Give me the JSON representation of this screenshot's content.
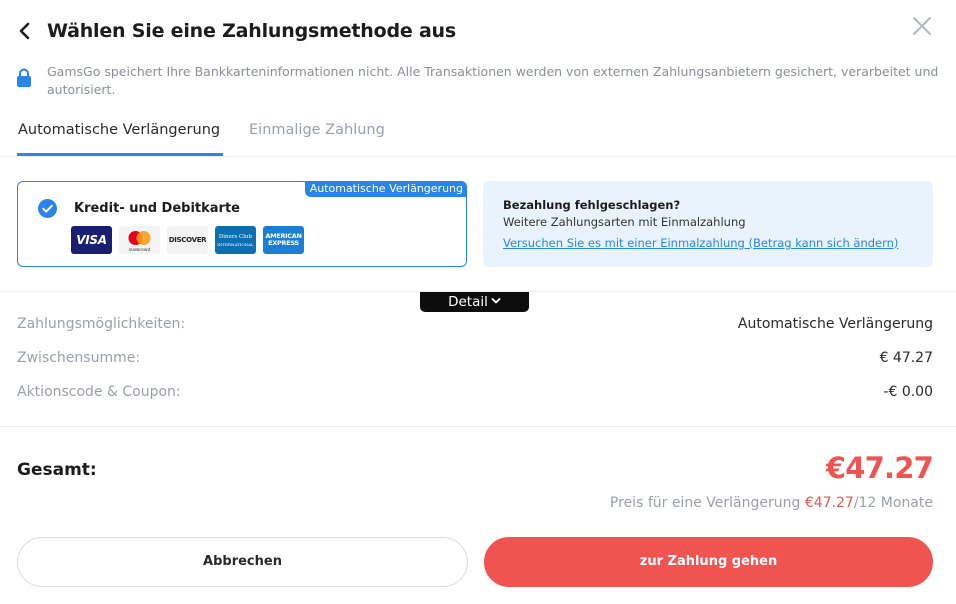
{
  "header": {
    "title": "Wählen Sie eine Zahlungsmethode aus"
  },
  "notice": {
    "text": "GamsGo speichert Ihre Bankkarteninformationen nicht. Alle Transaktionen werden von externen Zahlungsanbietern gesichert, verarbeitet und autorisiert."
  },
  "tabs": [
    {
      "label": "Automatische Verlängerung",
      "active": true
    },
    {
      "label": "Einmalige Zahlung",
      "active": false
    }
  ],
  "method": {
    "badge": "Automatische Verlängerung",
    "label": "Kredit- und Debitkarte",
    "cards": {
      "visa": "VISA",
      "mastercard": "mastercard",
      "discover": "DISCOVER",
      "diners_line1": "Diners Club",
      "diners_line2": "INTERNATIONAL",
      "amex_line1": "AMERICAN",
      "amex_line2": "EXPRESS"
    }
  },
  "info": {
    "title": "Bezahlung fehlgeschlagen?",
    "subtitle": "Weitere Zahlungsarten mit Einmalzahlung",
    "link": "Versuchen Sie es mit einer Einmalzahlung (Betrag kann sich ändern)"
  },
  "detail": {
    "label": "Detail"
  },
  "summary": [
    {
      "label": "Zahlungsmöglichkeiten:",
      "value": "Automatische Verlängerung"
    },
    {
      "label": "Zwischensumme:",
      "value": "€ 47.27"
    },
    {
      "label": "Aktionscode & Coupon:",
      "value": "-€ 0.00"
    }
  ],
  "total": {
    "label": "Gesamt:",
    "value": "€47.27",
    "renewal_prefix": "Preis für eine Verlängerung",
    "renewal_price": "€47.27",
    "renewal_suffix": "/12 Monate"
  },
  "buttons": {
    "cancel": "Abbrechen",
    "pay": "zur Zahlung gehen"
  },
  "colors": {
    "accent_blue": "#2a85e8",
    "price_red": "#ef5451",
    "info_bg": "#e9f3fd"
  }
}
